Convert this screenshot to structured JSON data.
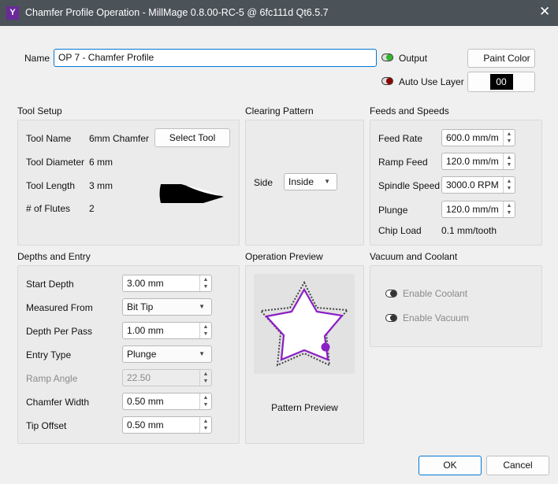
{
  "window": {
    "title": "Chamfer Profile Operation - MillMage 0.8.00-RC-5 @ 6fc111d Qt6.5.7",
    "close": "✕",
    "logo": "Y"
  },
  "header": {
    "name_label": "Name",
    "name_value": "OP 7 - Chamfer Profile",
    "output_label": "Output",
    "auto_use_layer_label": "Auto Use Layer",
    "paint_color_label": "Paint Color",
    "layer_value": "00"
  },
  "tool_setup": {
    "title": "Tool Setup",
    "tool_name_label": "Tool Name",
    "tool_name": "6mm Chamfer",
    "select_tool": "Select Tool",
    "diameter_label": "Tool Diameter",
    "diameter": "6 mm",
    "length_label": "Tool Length",
    "length": "3 mm",
    "flutes_label": "# of Flutes",
    "flutes": "2"
  },
  "clearing": {
    "title": "Clearing Pattern",
    "side_label": "Side",
    "side_value": "Inside"
  },
  "feeds": {
    "title": "Feeds and Speeds",
    "rows": [
      {
        "label": "Feed Rate",
        "value": "600.0 mm/m"
      },
      {
        "label": "Ramp Feed",
        "value": "120.0 mm/m"
      },
      {
        "label": "Spindle Speed",
        "value": "3000.0 RPM"
      },
      {
        "label": "Plunge",
        "value": "120.0 mm/m"
      }
    ],
    "chip_load_label": "Chip Load",
    "chip_load": "0.1 mm/tooth"
  },
  "depths": {
    "title": "Depths and Entry",
    "rows": [
      {
        "label": "Start Depth",
        "value": "3.00 mm"
      },
      {
        "label": "Measured From",
        "value": "Bit Tip"
      },
      {
        "label": "Depth Per Pass",
        "value": "1.00 mm"
      },
      {
        "label": "Entry Type",
        "value": "Plunge"
      },
      {
        "label": "Ramp Angle",
        "value": "22.50"
      },
      {
        "label": "Chamfer Width",
        "value": "0.50 mm"
      },
      {
        "label": "Tip Offset",
        "value": "0.50 mm"
      }
    ]
  },
  "preview": {
    "title": "Operation Preview",
    "caption": "Pattern Preview"
  },
  "vacuum": {
    "title": "Vacuum and Coolant",
    "coolant": "Enable Coolant",
    "vacuum": "Enable Vacuum"
  },
  "footer": {
    "ok": "OK",
    "cancel": "Cancel"
  },
  "colors": {
    "accent": "#0078d4",
    "toolpath": "#8a1fc4",
    "output_on": "#2db52d",
    "layer_off": "#8b0000"
  }
}
